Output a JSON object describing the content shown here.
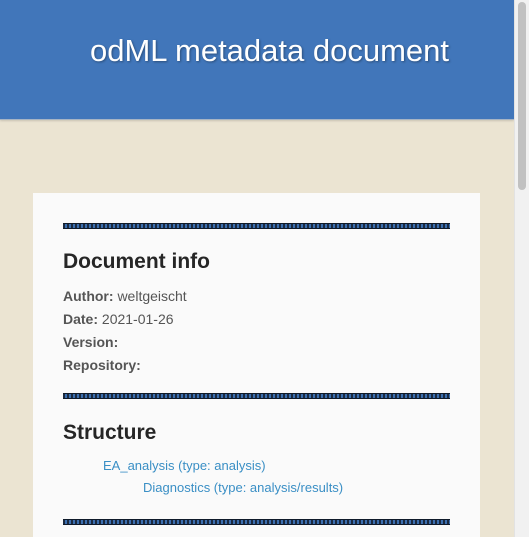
{
  "header": {
    "title": "odML metadata document"
  },
  "document_info": {
    "heading": "Document info",
    "author_label": "Author:",
    "author_value": "weltgeischt",
    "date_label": "Date:",
    "date_value": "2021-01-26",
    "version_label": "Version:",
    "version_value": "",
    "repository_label": "Repository:",
    "repository_value": ""
  },
  "structure": {
    "heading": "Structure",
    "items": [
      {
        "label": "EA_analysis (type: analysis)",
        "level": 1
      },
      {
        "label": "Diagnostics (type: analysis/results)",
        "level": 2
      }
    ]
  },
  "colors": {
    "header_bg": "#4176ba",
    "page_bg": "#ebe4d2",
    "card_bg": "#fafafa",
    "link": "#3a8fc5"
  }
}
